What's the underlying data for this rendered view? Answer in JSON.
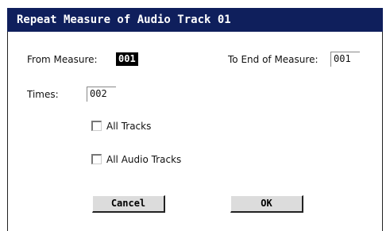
{
  "dialog": {
    "title": "Repeat Measure of Audio Track 01"
  },
  "from_measure": {
    "label": "From Measure:",
    "value": "001"
  },
  "to_end_measure": {
    "label": "To End of Measure:",
    "value": "001"
  },
  "times": {
    "label": "Times:",
    "value": "002"
  },
  "options": {
    "all_tracks": {
      "label": "All Tracks",
      "checked": false
    },
    "all_audio_tracks": {
      "label": "All Audio Tracks",
      "checked": false
    }
  },
  "buttons": {
    "cancel": "Cancel",
    "ok": "OK"
  },
  "colors": {
    "title_bar": "#0f1f5c",
    "selected_bg": "#000000",
    "button_bg": "#dcdcdc"
  }
}
